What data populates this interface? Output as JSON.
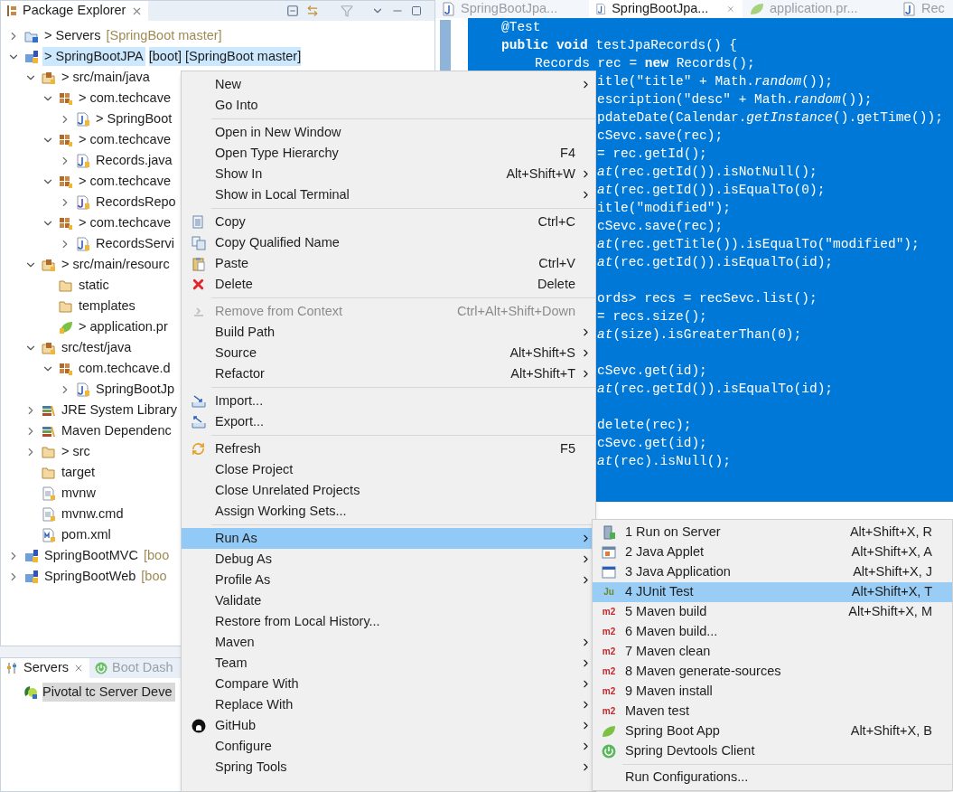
{
  "package_explorer": {
    "title": "Package Explorer",
    "tree": [
      {
        "label": "> Servers",
        "suffix": "[SpringBoot master]",
        "kind": "server-project",
        "expanded": false,
        "selected": false
      },
      {
        "label": "> SpringBootJPA",
        "suffix": "[boot] [SpringBoot master]",
        "kind": "project",
        "expanded": true,
        "selected": true,
        "children": [
          {
            "label": "> src/main/java",
            "kind": "source-folder",
            "expanded": true,
            "selected": false,
            "children": [
              {
                "label": "> com.techcave",
                "kind": "package",
                "expanded": true,
                "selected": false,
                "children": [
                  {
                    "label": "> SpringBoot",
                    "kind": "java-class",
                    "expanded": false,
                    "selected": false
                  }
                ]
              },
              {
                "label": "> com.techcave",
                "kind": "package",
                "expanded": true,
                "selected": false,
                "children": [
                  {
                    "label": "Records.java",
                    "kind": "java-file",
                    "expanded": false,
                    "selected": false
                  }
                ]
              },
              {
                "label": "> com.techcave",
                "kind": "package",
                "expanded": true,
                "selected": false,
                "children": [
                  {
                    "label": "RecordsRepo",
                    "kind": "java-interface",
                    "expanded": false,
                    "selected": false
                  }
                ]
              },
              {
                "label": "> com.techcave",
                "kind": "package",
                "expanded": true,
                "selected": false,
                "children": [
                  {
                    "label": "RecordsServi",
                    "kind": "java-class",
                    "expanded": false,
                    "selected": false
                  }
                ]
              }
            ]
          },
          {
            "label": "> src/main/resourc",
            "kind": "source-folder",
            "expanded": true,
            "selected": false,
            "children": [
              {
                "label": "static",
                "kind": "folder",
                "selected": false
              },
              {
                "label": "templates",
                "kind": "folder",
                "selected": false
              },
              {
                "label": "> application.pr",
                "kind": "properties",
                "selected": false
              }
            ]
          },
          {
            "label": "src/test/java",
            "kind": "source-folder",
            "expanded": true,
            "selected": false,
            "children": [
              {
                "label": "com.techcave.d",
                "kind": "package",
                "expanded": true,
                "selected": false,
                "children": [
                  {
                    "label": "SpringBootJp",
                    "kind": "java-file",
                    "expanded": false,
                    "selected": false
                  }
                ]
              }
            ]
          },
          {
            "label": "JRE System Library",
            "kind": "library",
            "expanded": false,
            "selected": false
          },
          {
            "label": "Maven Dependenc",
            "kind": "library",
            "expanded": false,
            "selected": false
          },
          {
            "label": "> src",
            "kind": "folder",
            "expanded": false,
            "selected": false
          },
          {
            "label": "target",
            "kind": "folder",
            "selected": false
          },
          {
            "label": "mvnw",
            "kind": "file",
            "selected": false
          },
          {
            "label": "mvnw.cmd",
            "kind": "file",
            "selected": false
          },
          {
            "label": "pom.xml",
            "kind": "xml-file",
            "selected": false
          }
        ]
      },
      {
        "label": "SpringBootMVC",
        "suffix": "[boo",
        "kind": "project",
        "expanded": false,
        "selected": false
      },
      {
        "label": "SpringBootWeb",
        "suffix": "[boo",
        "kind": "project",
        "expanded": false,
        "selected": false
      }
    ]
  },
  "servers_panel": {
    "tabs": [
      {
        "label": "Servers",
        "selected": true
      },
      {
        "label": "Boot Dash",
        "selected": false
      }
    ],
    "rows": [
      {
        "label": "Pivotal tc Server Deve",
        "selected": true
      }
    ]
  },
  "editor": {
    "tabs": [
      {
        "label": "SpringBootJpa...",
        "kind": "java",
        "selected": false
      },
      {
        "label": "SpringBootJpa...",
        "kind": "java",
        "selected": true
      },
      {
        "label": "application.pr...",
        "kind": "properties",
        "selected": false
      },
      {
        "label": "Rec",
        "kind": "java",
        "selected": false
      }
    ],
    "lines": [
      {
        "kind": "method",
        "text": "@Test"
      },
      {
        "kind": "method",
        "text": "**public** **void** testJpaRecords() {"
      },
      {
        "kind": "body",
        "text": "Records rec = **new** Records();"
      },
      {
        "kind": "clipped",
        "text": "itle(\"title\" + Math.*random*());"
      },
      {
        "kind": "clipped",
        "text": "escription(\"desc\" + Math.*random*());"
      },
      {
        "kind": "clipped",
        "text": "pdateDate(Calendar.*getInstance*().getTime());"
      },
      {
        "kind": "clipped",
        "text": "cSevc.save(rec);"
      },
      {
        "kind": "clipped",
        "text": "= rec.getId();"
      },
      {
        "kind": "clipped",
        "text": "*at*(rec.getId()).isNotNull();"
      },
      {
        "kind": "clipped",
        "text": "*at*(rec.getId()).isEqualTo(0);"
      },
      {
        "kind": "clipped",
        "text": "itle(\"modified\");"
      },
      {
        "kind": "clipped",
        "text": "cSevc.save(rec);"
      },
      {
        "kind": "clipped",
        "text": "*at*(rec.getTitle()).isEqualTo(\"modified\");"
      },
      {
        "kind": "clipped",
        "text": "*at*(rec.getId()).isEqualTo(id);"
      },
      {
        "kind": "blank"
      },
      {
        "kind": "clipped",
        "text": "ords> recs = recSevc.list();"
      },
      {
        "kind": "clipped",
        "text": "= recs.size();"
      },
      {
        "kind": "clipped",
        "text": "*at*(size).isGreaterThan(0);"
      },
      {
        "kind": "blank"
      },
      {
        "kind": "clipped",
        "text": "cSevc.get(id);"
      },
      {
        "kind": "clipped",
        "text": "*at*(rec.getId()).isEqualTo(id);"
      },
      {
        "kind": "blank"
      },
      {
        "kind": "clipped",
        "text": "delete(rec);"
      },
      {
        "kind": "clipped",
        "text": "cSevc.get(id);"
      },
      {
        "kind": "clipped",
        "text": "*at*(rec).isNull();"
      }
    ]
  },
  "context_menu": {
    "groups": [
      {
        "items": [
          {
            "label": "New",
            "kind": "plain",
            "submenu": true,
            "selected": false,
            "disabled": false
          },
          {
            "label": "Go Into",
            "kind": "plain",
            "submenu": false,
            "selected": false,
            "disabled": false
          }
        ]
      },
      {
        "items": [
          {
            "label": "Open in New Window",
            "kind": "plain",
            "submenu": false,
            "selected": false,
            "disabled": false
          },
          {
            "label": "Open Type Hierarchy",
            "shortcut": "F4",
            "kind": "plain",
            "submenu": false,
            "selected": false,
            "disabled": false
          },
          {
            "label": "Show In",
            "shortcut": "Alt+Shift+W",
            "kind": "plain",
            "submenu": true,
            "selected": false,
            "disabled": false
          },
          {
            "label": "Show in Local Terminal",
            "kind": "plain",
            "submenu": true,
            "selected": false,
            "disabled": false
          }
        ]
      },
      {
        "items": [
          {
            "label": "Copy",
            "shortcut": "Ctrl+C",
            "kind": "copy",
            "submenu": false,
            "selected": false,
            "disabled": false
          },
          {
            "label": "Copy Qualified Name",
            "kind": "copy-name",
            "submenu": false,
            "selected": false,
            "disabled": false
          },
          {
            "label": "Paste",
            "shortcut": "Ctrl+V",
            "kind": "paste",
            "submenu": false,
            "selected": false,
            "disabled": false
          },
          {
            "label": "Delete",
            "shortcut": "Delete",
            "kind": "delete",
            "submenu": false,
            "selected": false,
            "disabled": false
          }
        ]
      },
      {
        "items": [
          {
            "label": "Remove from Context",
            "shortcut": "Ctrl+Alt+Shift+Down",
            "kind": "remove",
            "submenu": false,
            "selected": false,
            "disabled": true
          },
          {
            "label": "Build Path",
            "kind": "plain",
            "submenu": true,
            "selected": false,
            "disabled": false
          },
          {
            "label": "Source",
            "shortcut": "Alt+Shift+S",
            "kind": "plain",
            "submenu": true,
            "selected": false,
            "disabled": false
          },
          {
            "label": "Refactor",
            "shortcut": "Alt+Shift+T",
            "kind": "plain",
            "submenu": true,
            "selected": false,
            "disabled": false
          }
        ]
      },
      {
        "items": [
          {
            "label": "Import...",
            "kind": "import",
            "submenu": false,
            "selected": false,
            "disabled": false
          },
          {
            "label": "Export...",
            "kind": "export",
            "submenu": false,
            "selected": false,
            "disabled": false
          }
        ]
      },
      {
        "items": [
          {
            "label": "Refresh",
            "shortcut": "F5",
            "kind": "refresh",
            "submenu": false,
            "selected": false,
            "disabled": false
          },
          {
            "label": "Close Project",
            "kind": "plain",
            "submenu": false,
            "selected": false,
            "disabled": false
          },
          {
            "label": "Close Unrelated Projects",
            "kind": "plain",
            "submenu": false,
            "selected": false,
            "disabled": false
          },
          {
            "label": "Assign Working Sets...",
            "kind": "plain",
            "submenu": false,
            "selected": false,
            "disabled": false
          }
        ]
      },
      {
        "items": [
          {
            "label": "Run As",
            "kind": "plain",
            "submenu": true,
            "selected": true,
            "disabled": false
          },
          {
            "label": "Debug As",
            "kind": "plain",
            "submenu": true,
            "selected": false,
            "disabled": false
          },
          {
            "label": "Profile As",
            "kind": "plain",
            "submenu": true,
            "selected": false,
            "disabled": false
          },
          {
            "label": "Validate",
            "kind": "plain",
            "submenu": false,
            "selected": false,
            "disabled": false
          },
          {
            "label": "Restore from Local History...",
            "kind": "plain",
            "submenu": false,
            "selected": false,
            "disabled": false
          },
          {
            "label": "Maven",
            "kind": "plain",
            "submenu": true,
            "selected": false,
            "disabled": false
          },
          {
            "label": "Team",
            "kind": "plain",
            "submenu": true,
            "selected": false,
            "disabled": false
          },
          {
            "label": "Compare With",
            "kind": "plain",
            "submenu": true,
            "selected": false,
            "disabled": false
          },
          {
            "label": "Replace With",
            "kind": "plain",
            "submenu": true,
            "selected": false,
            "disabled": false
          },
          {
            "label": "GitHub",
            "kind": "github",
            "submenu": true,
            "selected": false,
            "disabled": false
          },
          {
            "label": "Configure",
            "kind": "plain",
            "submenu": true,
            "selected": false,
            "disabled": false
          },
          {
            "label": "Spring Tools",
            "kind": "plain",
            "submenu": true,
            "selected": false,
            "disabled": false
          }
        ]
      }
    ]
  },
  "submenu": {
    "groups": [
      {
        "items": [
          {
            "label": "1 Run on Server",
            "shortcut": "Alt+Shift+X, R",
            "kind": "server",
            "selected": false
          },
          {
            "label": "2 Java Applet",
            "shortcut": "Alt+Shift+X, A",
            "kind": "applet",
            "selected": false
          },
          {
            "label": "3 Java Application",
            "shortcut": "Alt+Shift+X, J",
            "kind": "application",
            "selected": false
          },
          {
            "label": "4 JUnit Test",
            "shortcut": "Alt+Shift+X, T",
            "kind": "badge",
            "badge": "Ju",
            "selected": true
          },
          {
            "label": "5 Maven build",
            "shortcut": "Alt+Shift+X, M",
            "kind": "badge",
            "badge": "m2",
            "selected": false
          },
          {
            "label": "6 Maven build...",
            "kind": "badge",
            "badge": "m2",
            "selected": false
          },
          {
            "label": "7 Maven clean",
            "kind": "badge",
            "badge": "m2",
            "selected": false
          },
          {
            "label": "8 Maven generate-sources",
            "kind": "badge",
            "badge": "m2",
            "selected": false
          },
          {
            "label": "9 Maven install",
            "kind": "badge",
            "badge": "m2",
            "selected": false
          },
          {
            "label": "Maven test",
            "kind": "badge",
            "badge": "m2",
            "selected": false
          },
          {
            "label": "Spring Boot App",
            "shortcut": "Alt+Shift+X, B",
            "kind": "leaf",
            "selected": false
          },
          {
            "label": "Spring Devtools Client",
            "kind": "power",
            "selected": false
          }
        ]
      },
      {
        "items": [
          {
            "label": "Run Configurations...",
            "kind": "plain",
            "selected": false
          }
        ]
      }
    ]
  }
}
